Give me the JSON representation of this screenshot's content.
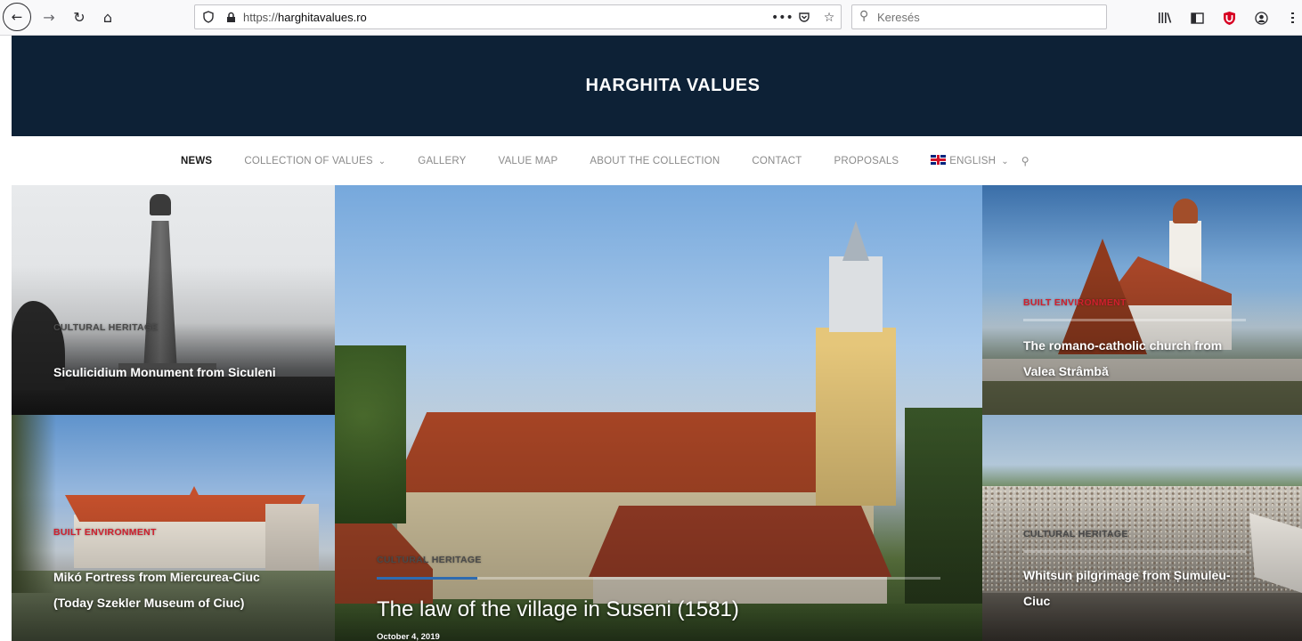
{
  "browser": {
    "url_scheme": "https://",
    "url_host": "harghitavalues.ro",
    "search_placeholder": "Keresés",
    "page_actions_icon": "•••",
    "icons": [
      "back-icon",
      "forward-icon",
      "reload-icon",
      "home-icon",
      "tracking-shield-icon",
      "lock-icon",
      "page-actions-icon",
      "pocket-icon",
      "bookmark-star-icon",
      "search-icon",
      "library-icon",
      "sidebar-icon",
      "ublock-icon",
      "account-icon",
      "menu-icon"
    ]
  },
  "site": {
    "title": "HARGHITA VALUES"
  },
  "nav": {
    "items": [
      {
        "label": "NEWS",
        "active": true
      },
      {
        "label": "COLLECTION OF VALUES",
        "dropdown": true
      },
      {
        "label": "GALLERY"
      },
      {
        "label": "VALUE MAP"
      },
      {
        "label": "ABOUT THE COLLECTION"
      },
      {
        "label": "CONTACT"
      },
      {
        "label": "PROPOSALS"
      }
    ],
    "language": "ENGLISH",
    "colors": {
      "active": "#1a1a1a",
      "inactive": "#8a8a8a"
    }
  },
  "posts": {
    "top_left": {
      "category": "CULTURAL HERITAGE",
      "title": "Siculicidium Monument from Siculeni",
      "category_color": "#4a4a4a"
    },
    "bottom_left": {
      "category": "BUILT ENVIRONMENT",
      "title_line1": "Mikó Fortress from Miercurea-Ciuc",
      "title_line2": "(Today Szekler Museum of Ciuc)",
      "category_color": "#d0202e"
    },
    "center": {
      "category": "CULTURAL HERITAGE",
      "title": "The law of the village in Suseni (1581)",
      "date": "October 4, 2019",
      "category_color": "#4a4a4a"
    },
    "top_right": {
      "category": "BUILT ENVIRONMENT",
      "title_line1": "The romano-catholic church from",
      "title_line2": "Valea Strâmbă",
      "category_color": "#d0202e"
    },
    "bottom_right": {
      "category": "CULTURAL HERITAGE",
      "title_line1": "Whitsun pilgrimage from Șumuleu-",
      "title_line2": "Ciuc",
      "category_color": "#4a4a4a"
    }
  },
  "colors": {
    "header_bg": "#0d2136",
    "header_text": "#ffffff",
    "category_red": "#d0202e"
  }
}
